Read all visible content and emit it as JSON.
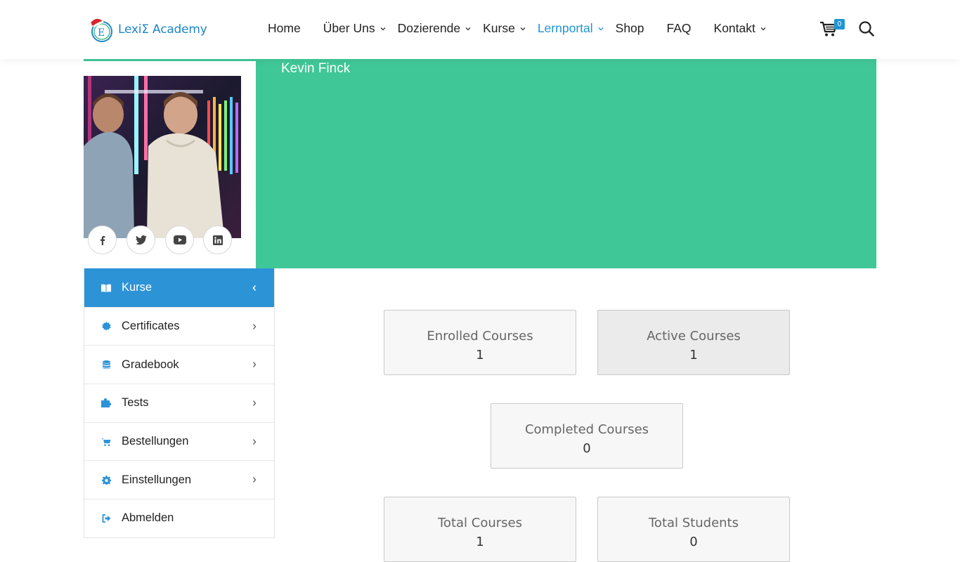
{
  "brand": {
    "name": "LexiΣ Academy",
    "accent": "#1f95d6",
    "green": "#40c798"
  },
  "nav": {
    "items": [
      {
        "label": "Home",
        "dropdown": false,
        "active": false
      },
      {
        "label": "Über Uns",
        "dropdown": true,
        "active": false
      },
      {
        "label": "Dozierende",
        "dropdown": true,
        "active": false
      },
      {
        "label": "Kurse",
        "dropdown": true,
        "active": false
      },
      {
        "label": "Lernportal",
        "dropdown": true,
        "active": true
      },
      {
        "label": "Shop",
        "dropdown": false,
        "active": false
      },
      {
        "label": "FAQ",
        "dropdown": false,
        "active": false
      },
      {
        "label": "Kontakt",
        "dropdown": true,
        "active": false
      }
    ],
    "cart_count": "0"
  },
  "profile": {
    "name": "Kevin Finck",
    "social": [
      "facebook-icon",
      "twitter-icon",
      "youtube-icon",
      "linkedin-icon"
    ]
  },
  "sidebar": {
    "items": [
      {
        "label": "Kurse",
        "icon": "book-icon",
        "active": true,
        "arrow": "chevron-left"
      },
      {
        "label": "Certificates",
        "icon": "certificate-icon",
        "active": false,
        "arrow": "chevron-right"
      },
      {
        "label": "Gradebook",
        "icon": "database-icon",
        "active": false,
        "arrow": "chevron-right"
      },
      {
        "label": "Tests",
        "icon": "puzzle-icon",
        "active": false,
        "arrow": "chevron-right"
      },
      {
        "label": "Bestellungen",
        "icon": "cart-icon",
        "active": false,
        "arrow": "chevron-right"
      },
      {
        "label": "Einstellungen",
        "icon": "gear-icon",
        "active": false,
        "arrow": "chevron-right"
      },
      {
        "label": "Abmelden",
        "icon": "sign-out-icon",
        "active": false,
        "arrow": ""
      }
    ]
  },
  "stats": [
    {
      "label": "Enrolled Courses",
      "value": "1"
    },
    {
      "label": "Active Courses",
      "value": "1"
    },
    {
      "label": "Completed Courses",
      "value": "0"
    },
    {
      "label": "Total Courses",
      "value": "1"
    },
    {
      "label": "Total Students",
      "value": "0"
    }
  ]
}
